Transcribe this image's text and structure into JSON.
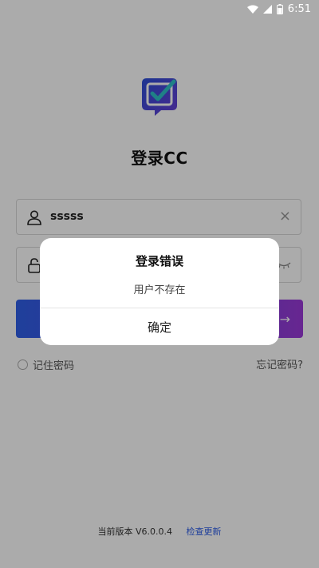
{
  "status_bar": {
    "time": "6:51"
  },
  "app": {
    "title": "登录CC"
  },
  "username": {
    "value": "sssss"
  },
  "login_button": {
    "arrow": "→"
  },
  "remember": {
    "label": "记住密码"
  },
  "forgot": {
    "label": "忘记密码?"
  },
  "footer": {
    "version": "当前版本 V6.0.0.4",
    "check_update": "检查更新"
  },
  "dialog": {
    "title": "登录错误",
    "message": "用户不存在",
    "ok_label": "确定"
  },
  "colors": {
    "accent_start": "#2f5fe8",
    "accent_end": "#9b3ad8",
    "link": "#2f5fe8"
  }
}
